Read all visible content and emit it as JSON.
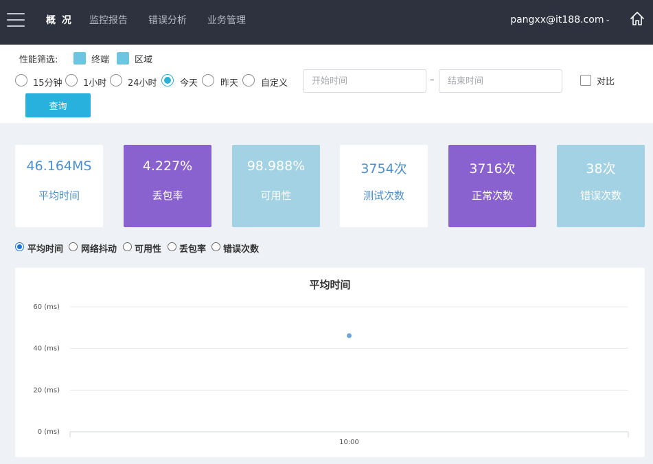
{
  "nav": {
    "items": [
      "概 况",
      "监控报告",
      "错误分析",
      "业务管理"
    ],
    "user": "pangxx@it188.com",
    "caret": "⌄"
  },
  "filter": {
    "label": "性能筛选:",
    "legend": [
      {
        "text": "终端",
        "color": "#6ec5e1"
      },
      {
        "text": "区域",
        "color": "#6ec5e1"
      }
    ],
    "ranges": [
      {
        "label": "15分钟",
        "checked": false
      },
      {
        "label": "1小时",
        "checked": false
      },
      {
        "label": "24小时",
        "checked": false
      },
      {
        "label": "今天",
        "checked": true
      },
      {
        "label": "昨天",
        "checked": false
      },
      {
        "label": "自定义",
        "checked": false
      }
    ],
    "start_placeholder": "开始时间",
    "end_placeholder": "结束时间",
    "dash": "–",
    "compare_label": "对比",
    "query_label": "查询"
  },
  "cards": [
    {
      "value": "46.164MS",
      "label": "平均时间",
      "style": "white"
    },
    {
      "value": "4.227%",
      "label": "丢包率",
      "style": "purple"
    },
    {
      "value": "98.988%",
      "label": "可用性",
      "style": "lblue"
    },
    {
      "value": "3754次",
      "label": "测试次数",
      "style": "white"
    },
    {
      "value": "3716次",
      "label": "正常次数",
      "style": "purple"
    },
    {
      "value": "38次",
      "label": "错误次数",
      "style": "lblue"
    }
  ],
  "metrics": [
    {
      "label": "平均时间",
      "checked": true
    },
    {
      "label": "网络抖动",
      "checked": false
    },
    {
      "label": "可用性",
      "checked": false
    },
    {
      "label": "丢包率",
      "checked": false
    },
    {
      "label": "错误次数",
      "checked": false
    }
  ],
  "colors": {
    "accent": "#29b1dd",
    "purple": "#8a62d0",
    "light_blue": "#a2d2e3",
    "nav_bg": "#2d323e",
    "point": "#6aa6db"
  },
  "chart_data": {
    "type": "scatter",
    "title": "平均时间",
    "x": [
      "10:00"
    ],
    "series": [
      {
        "values": [
          46.164
        ]
      }
    ],
    "y_ticks": [
      "0 (ms)",
      "20 (ms)",
      "40 (ms)",
      "60 (ms)"
    ],
    "ylim": [
      0,
      60
    ],
    "grid": true
  }
}
